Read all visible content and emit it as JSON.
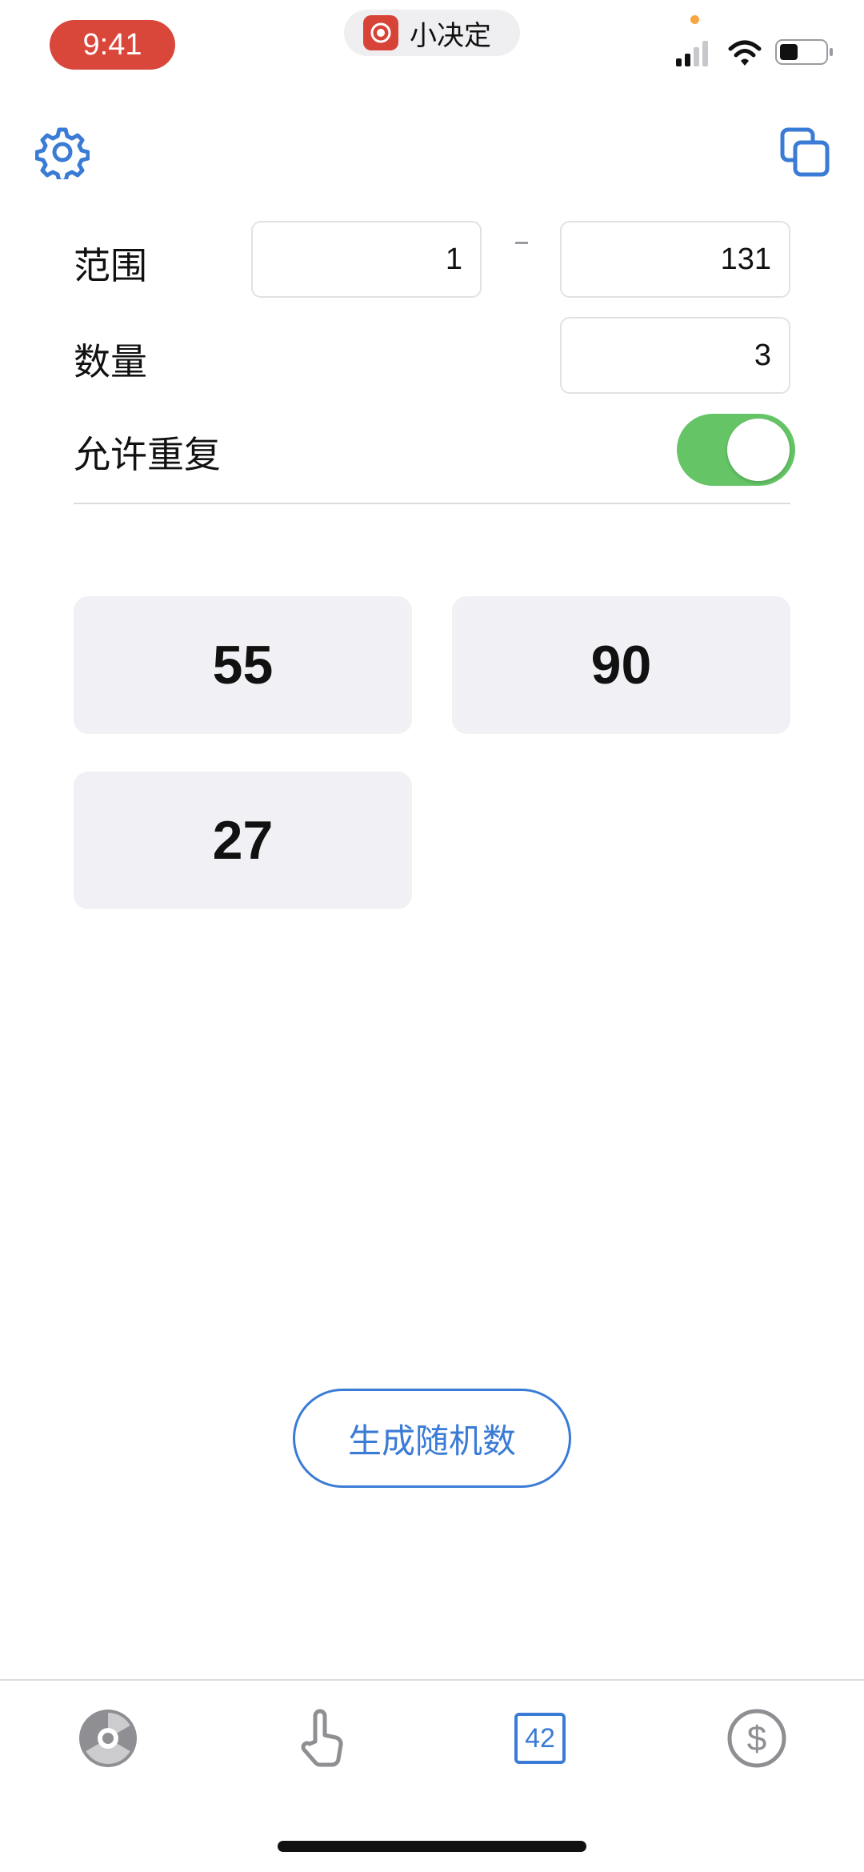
{
  "status_bar": {
    "time": "9:41",
    "app_name": "小决定",
    "icons": [
      "signal-icon",
      "wifi-icon",
      "battery-icon"
    ]
  },
  "toolbar": {
    "settings_icon": "gear-icon",
    "copy_icon": "copy-icon"
  },
  "form": {
    "range_label": "范围",
    "range_min": "1",
    "range_max": "131",
    "count_label": "数量",
    "count_value": "3",
    "allow_repeat_label": "允许重复",
    "allow_repeat_on": true
  },
  "results": [
    "55",
    "90",
    "27"
  ],
  "generate_button": "生成随机数",
  "tab_bar": {
    "tabs": [
      {
        "icon": "wheel-icon"
      },
      {
        "icon": "tap-hand-icon"
      },
      {
        "icon": "number-icon",
        "label": "42",
        "active": true
      },
      {
        "icon": "dollar-coin-icon"
      }
    ]
  },
  "colors": {
    "accent": "#3a7bd5",
    "toggle_on": "#65c466",
    "time_pill": "#d9473b",
    "card_bg": "#f1f1f5"
  }
}
